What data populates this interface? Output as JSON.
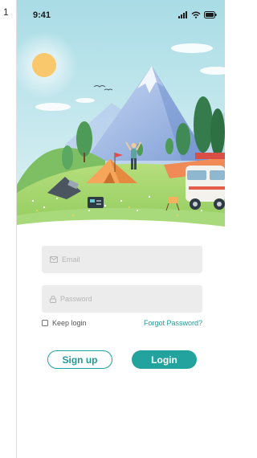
{
  "page_index": "1",
  "status_bar": {
    "time": "9:41",
    "icons": [
      "signal-icon",
      "wifi-icon",
      "battery-icon"
    ]
  },
  "hero": {
    "illustration": "camping-mountain-illustration"
  },
  "login": {
    "email": {
      "placeholder": "Email",
      "icon": "mail-icon",
      "value": ""
    },
    "password": {
      "placeholder": "Password",
      "icon": "lock-icon",
      "value": ""
    },
    "keep_login": {
      "label": "Keep login",
      "checked": false
    },
    "forgot_password": "Forgot Password?",
    "signup_label": "Sign up",
    "login_label": "Login"
  },
  "colors": {
    "accent": "#22a39d",
    "field_bg": "#ececec",
    "sky": "#bfe6ec",
    "mountain": "#a9c4e8",
    "grass": "#9fd36a"
  }
}
